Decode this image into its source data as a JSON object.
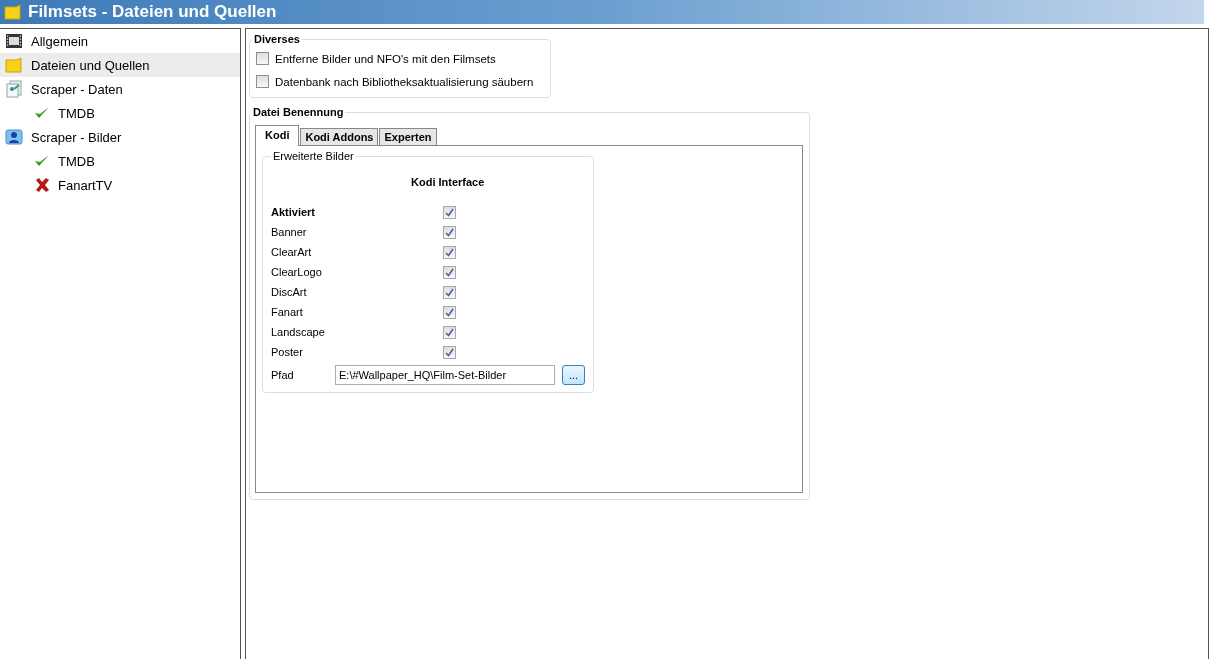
{
  "window": {
    "title": "Filmsets - Dateien und Quellen"
  },
  "sidebar": {
    "items": [
      {
        "label": "Allgemein",
        "kind": "film",
        "selected": false
      },
      {
        "label": "Dateien und Quellen",
        "kind": "folder",
        "selected": true
      },
      {
        "label": "Scraper - Daten",
        "kind": "data",
        "selected": false,
        "children": [
          {
            "label": "TMDB",
            "kind": "enabled",
            "selected": false
          }
        ]
      },
      {
        "label": "Scraper - Bilder",
        "kind": "images",
        "selected": false,
        "children": [
          {
            "label": "TMDB",
            "kind": "enabled",
            "selected": false
          },
          {
            "label": "FanartTV",
            "kind": "disabled",
            "selected": false
          }
        ]
      }
    ]
  },
  "diverses": {
    "title": "Diverses",
    "options": [
      {
        "label": "Entferne Bilder und NFO's mit den Filmsets",
        "checked": false
      },
      {
        "label": "Datenbank nach Bibliotheksaktualisierung säubern",
        "checked": false
      }
    ]
  },
  "naming": {
    "title": "Datei Benennung",
    "tabs": [
      {
        "label": "Kodi",
        "selected": true
      },
      {
        "label": "Kodi Addons",
        "selected": false
      },
      {
        "label": "Experten",
        "selected": false
      }
    ],
    "group": {
      "title": "Erweiterte Bilder",
      "column": "Kodi Interface",
      "rows": [
        {
          "label": "Aktiviert",
          "bold": true,
          "checked": true
        },
        {
          "label": "Banner",
          "bold": false,
          "checked": true
        },
        {
          "label": "ClearArt",
          "bold": false,
          "checked": true
        },
        {
          "label": "ClearLogo",
          "bold": false,
          "checked": true
        },
        {
          "label": "DiscArt",
          "bold": false,
          "checked": true
        },
        {
          "label": "Fanart",
          "bold": false,
          "checked": true
        },
        {
          "label": "Landscape",
          "bold": false,
          "checked": true
        },
        {
          "label": "Poster",
          "bold": false,
          "checked": true
        }
      ],
      "path": {
        "label": "Pfad",
        "value": "E:\\#Wallpaper_HQ\\Film-Set-Bilder",
        "button": "..."
      }
    }
  }
}
